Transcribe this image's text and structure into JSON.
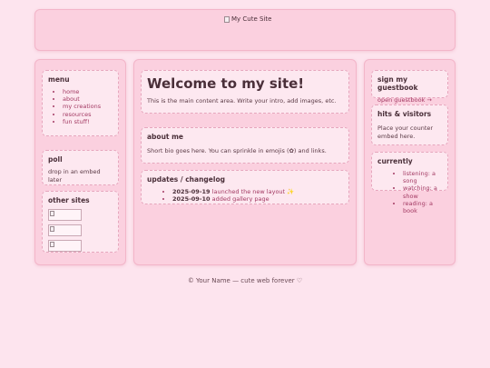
{
  "header": {
    "banner_alt": "My Cute Site"
  },
  "left": {
    "menu_title": "menu",
    "menu_items": [
      "home",
      "about",
      "my creations",
      "resources",
      "fun stuff!"
    ],
    "poll_title": "poll",
    "poll_text": "drop in an embed later",
    "other_sites_title": "other sites"
  },
  "main": {
    "welcome_title": "Welcome to my site!",
    "welcome_text": "This is the main content area. Write your intro, add images, etc.",
    "about_title": "about me",
    "about_text": "Short bio goes here. You can sprinkle in emojis (✿) and links.",
    "updates_title": "updates / changelog",
    "updates": [
      {
        "date": "2025-09-19",
        "text": "launched the new layout ✨"
      },
      {
        "date": "2025-09-10",
        "text": "added gallery page"
      }
    ]
  },
  "right": {
    "guestbook_title": "sign my guestbook",
    "guestbook_link": "open guestbook →",
    "hits_title": "hits & visitors",
    "hits_text": "Place your counter embed here.",
    "currently_title": "currently",
    "currently_items": [
      "listening: a song",
      "watching: a show",
      "reading: a book"
    ]
  },
  "footer": {
    "text": "© Your Name — cute web forever ♡"
  },
  "colors": {
    "background": "#fde4ee",
    "panel": "#fbd0df",
    "card": "#fde8f0",
    "link": "#a33a63"
  }
}
